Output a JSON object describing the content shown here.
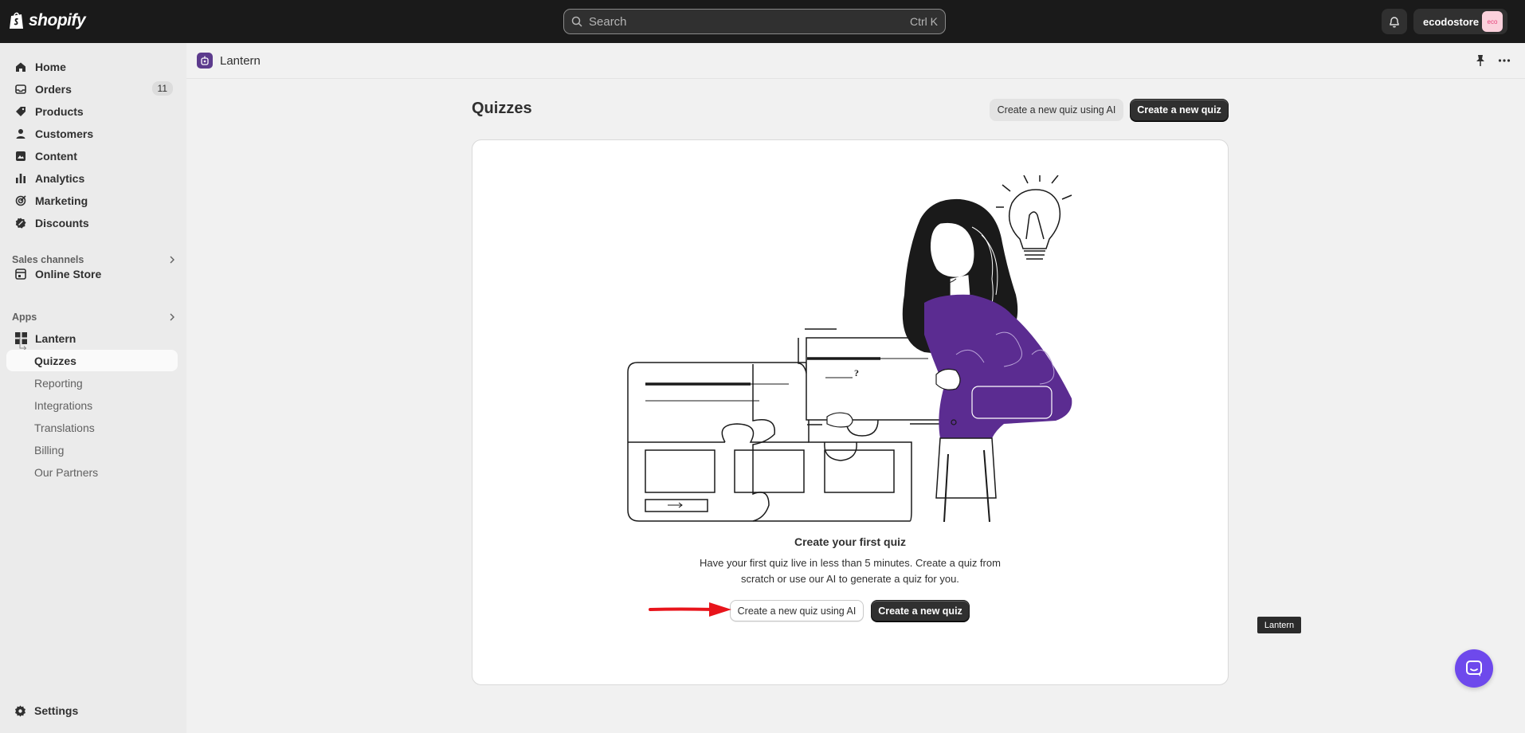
{
  "topbar": {
    "logo_text": "shopify",
    "search_placeholder": "Search",
    "search_shortcut": "Ctrl K",
    "store_name": "ecodostore",
    "store_avatar": "eco"
  },
  "sidebar": {
    "items": [
      {
        "label": "Home",
        "icon": "home-icon"
      },
      {
        "label": "Orders",
        "icon": "orders-icon",
        "badge": "11"
      },
      {
        "label": "Products",
        "icon": "tag-icon"
      },
      {
        "label": "Customers",
        "icon": "person-icon"
      },
      {
        "label": "Content",
        "icon": "content-icon"
      },
      {
        "label": "Analytics",
        "icon": "bar-chart-icon"
      },
      {
        "label": "Marketing",
        "icon": "target-icon"
      },
      {
        "label": "Discounts",
        "icon": "discount-icon"
      }
    ],
    "sales_channels_title": "Sales channels",
    "online_store": "Online Store",
    "apps_title": "Apps",
    "app_name": "Lantern",
    "app_sub_items": [
      "Quizzes",
      "Reporting",
      "Integrations",
      "Translations",
      "Billing",
      "Our Partners"
    ],
    "settings": "Settings"
  },
  "app_header": {
    "title": "Lantern"
  },
  "page": {
    "title": "Quizzes",
    "btn_ai": "Create a new quiz using AI",
    "btn_new": "Create a new quiz"
  },
  "empty_state": {
    "title": "Create your first quiz",
    "description": "Have your first quiz live in less than 5 minutes. Create a quiz from scratch or use our AI to generate a quiz for you.",
    "btn_ai": "Create a new quiz using AI",
    "btn_new": "Create a new quiz",
    "illustration_q_mark": "?"
  },
  "tooltip": "Lantern",
  "colors": {
    "topbar": "#1a1a1a",
    "accent_purple": "#5b2c91",
    "chat_button": "#6e49ec",
    "annotation_arrow": "#e8141b"
  }
}
